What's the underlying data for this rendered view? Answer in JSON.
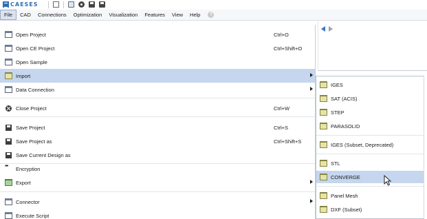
{
  "app": {
    "logo_text": "CAESES"
  },
  "toolbar": {
    "icons": [
      "new-page-icon",
      "open-folder-icon",
      "settings-icon",
      "save-icon",
      "save-all-icon"
    ]
  },
  "menubar": {
    "items": [
      "File",
      "CAD",
      "Connections",
      "Optimization",
      "Visualization",
      "Features",
      "View",
      "Help"
    ],
    "help_icon": "?"
  },
  "file_menu": {
    "items": [
      {
        "label": "Open Project",
        "shortcut": "Ctrl+O",
        "icon": "window-icon"
      },
      {
        "label": "Open CE Project",
        "shortcut": "Ctrl+Shift+O",
        "icon": "window-icon"
      },
      {
        "label": "Open Sample",
        "shortcut": "",
        "icon": "window-icon"
      },
      {
        "label": "Import",
        "shortcut": "",
        "icon": "folder-icon",
        "submenu": true,
        "highlighted": true
      },
      {
        "label": "Data Connection",
        "shortcut": "",
        "icon": "window-icon",
        "submenu": true
      },
      {
        "label": "Close Project",
        "shortcut": "Ctrl+W",
        "icon": "close-icon"
      },
      {
        "label": "Save Project",
        "shortcut": "Ctrl+S",
        "icon": "disk-icon"
      },
      {
        "label": "Save Project as",
        "shortcut": "Ctrl+Shift+S",
        "icon": "disk-icon"
      },
      {
        "label": "Save Current Design as",
        "shortcut": "",
        "icon": "disk-icon"
      },
      {
        "label": "Encryption",
        "shortcut": "",
        "icon": "dots-icon"
      },
      {
        "label": "Export",
        "shortcut": "",
        "icon": "export-folder-icon",
        "submenu": true
      },
      {
        "label": "Connector",
        "shortcut": "",
        "icon": "window-icon",
        "submenu": true
      },
      {
        "label": "Execute Script",
        "shortcut": "",
        "icon": "window-icon"
      }
    ]
  },
  "import_submenu": {
    "items": [
      {
        "label": "IGES"
      },
      {
        "label": "SAT (ACIS)"
      },
      {
        "label": "STEP"
      },
      {
        "label": "PARASOLID"
      },
      {
        "label": "IGES (Subset, Deprecated)"
      },
      {
        "label": "STL"
      },
      {
        "label": "CONVERGE",
        "highlighted": true
      },
      {
        "label": "Panel Mesh"
      },
      {
        "label": "DXF (Subset)"
      }
    ]
  },
  "colors": {
    "highlight": "#c5d6ee",
    "brand": "#2f6fb8",
    "folder": "#e6e3a8",
    "export_folder": "#a8d39c"
  }
}
